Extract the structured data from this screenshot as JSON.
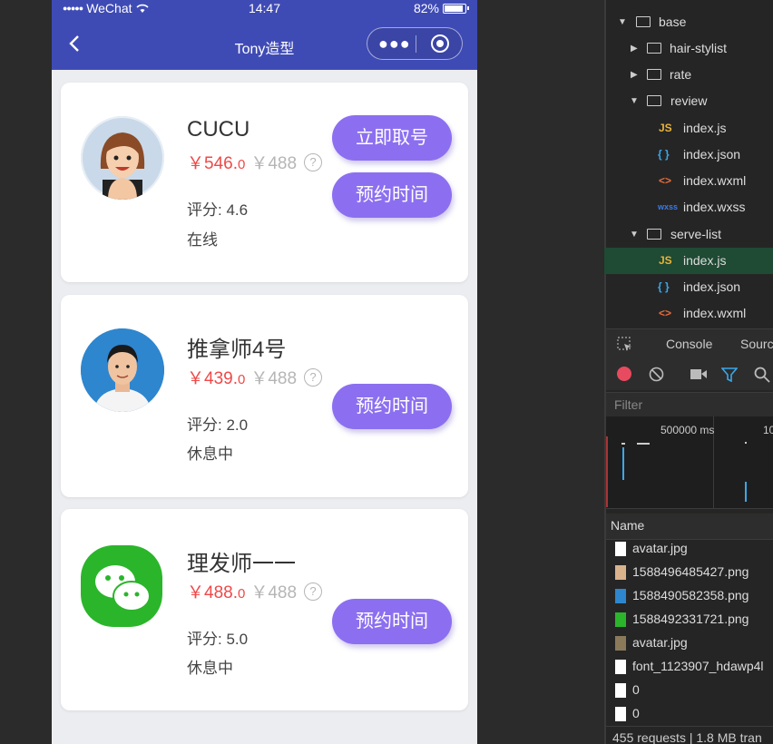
{
  "status_bar": {
    "carrier": "WeChat",
    "time": "14:47",
    "battery": "82%"
  },
  "nav": {
    "title": "Tony造型"
  },
  "stylists": [
    {
      "name": "CUCU",
      "price_now": "￥546.",
      "price_now_decimal": "0",
      "price_old": "￥488",
      "rating": "评分: 4.6",
      "status": "在线",
      "buttons": [
        "立即取号",
        "预约时间"
      ]
    },
    {
      "name": "推拿师4号",
      "price_now": "￥439.",
      "price_now_decimal": "0",
      "price_old": "￥488",
      "rating": "评分: 2.0",
      "status": "休息中",
      "buttons": [
        "预约时间"
      ]
    },
    {
      "name": "理发师一一",
      "price_now": "￥488.",
      "price_now_decimal": "0",
      "price_old": "￥488",
      "rating": "评分: 5.0",
      "status": "休息中",
      "buttons": [
        "预约时间"
      ]
    }
  ],
  "help_glyph": "?",
  "devtools": {
    "tree": [
      {
        "label": "base",
        "type": "folder-open"
      },
      {
        "label": "hair-stylist",
        "type": "folder"
      },
      {
        "label": "rate",
        "type": "folder"
      },
      {
        "label": "review",
        "type": "folder-open"
      },
      {
        "label": "index.js",
        "type": "js"
      },
      {
        "label": "index.json",
        "type": "json"
      },
      {
        "label": "index.wxml",
        "type": "wxml"
      },
      {
        "label": "index.wxss",
        "type": "wxss"
      },
      {
        "label": "serve-list",
        "type": "folder-open"
      },
      {
        "label": "index.js",
        "type": "js",
        "active": true
      },
      {
        "label": "index.json",
        "type": "json"
      },
      {
        "label": "index.wxml",
        "type": "wxml"
      }
    ],
    "tabs": [
      "Console",
      "Sourc"
    ],
    "filter_placeholder": "Filter",
    "timeline_labels": [
      "500000 ms",
      "10"
    ],
    "name_header": "Name",
    "requests": [
      "avatar.jpg",
      "1588496485427.png",
      "1588490582358.png",
      "1588492331721.png",
      "avatar.jpg",
      "font_1123907_hdawp4l",
      "0",
      "0"
    ],
    "footer": "455 requests | 1.8 MB tran",
    "icons": {
      "js": "JS",
      "json": "{ }",
      "wxml": "<>",
      "wxss": "wxss"
    }
  }
}
